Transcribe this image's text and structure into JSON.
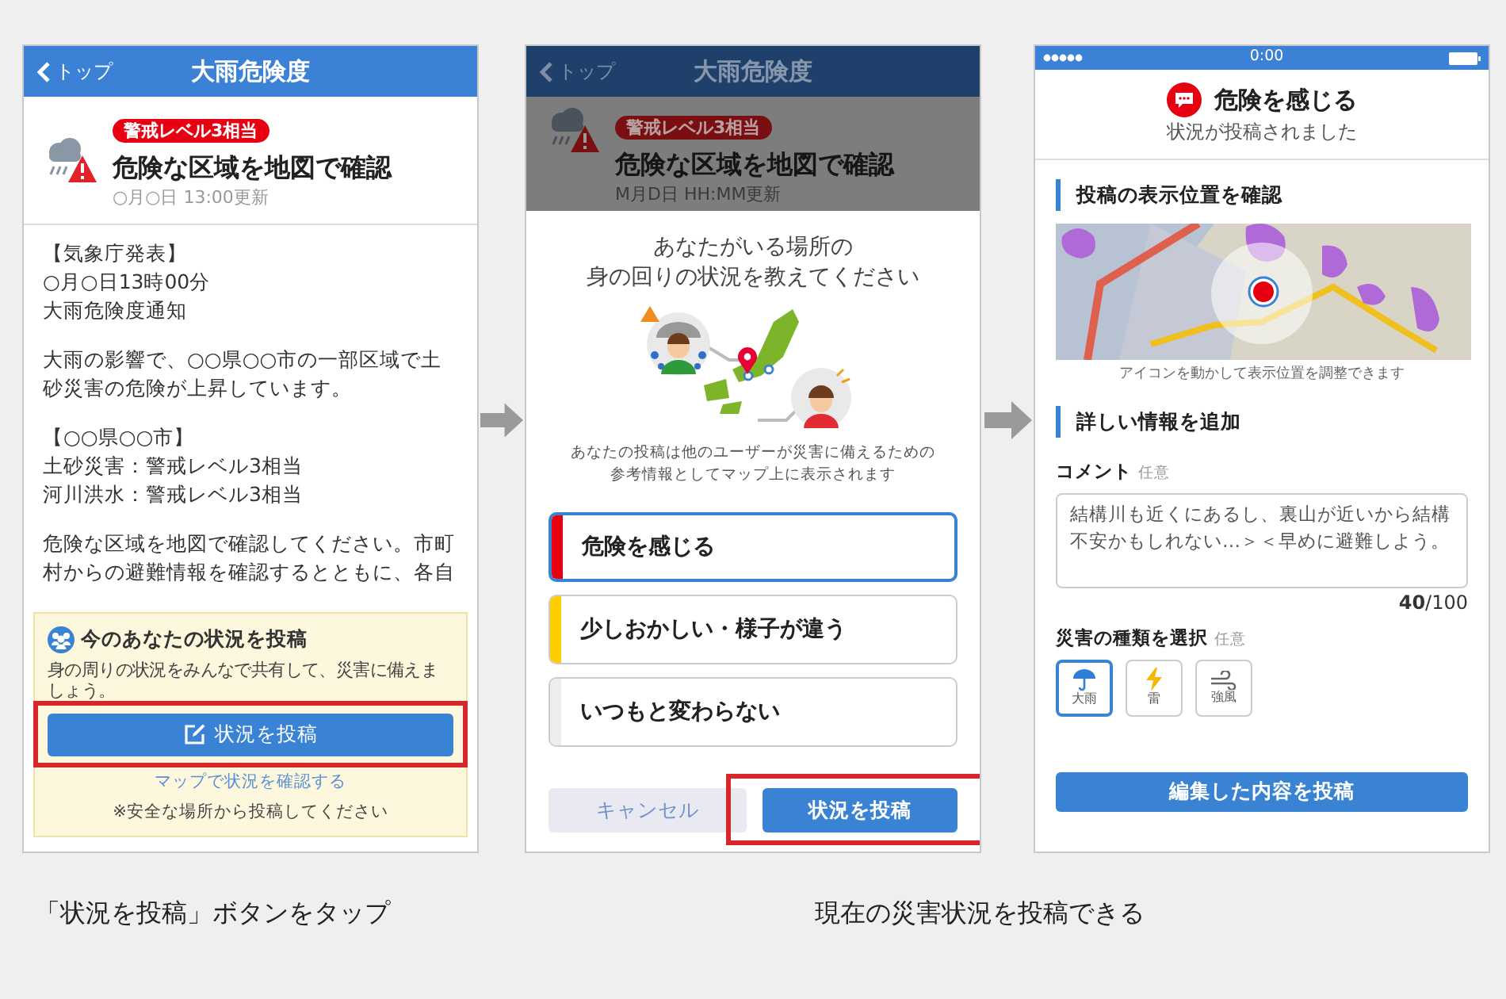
{
  "alert_screen": {
    "back": "トップ",
    "title": "大雨危険度",
    "badge": "警戒レベル3相当",
    "headline": "危険な区域を地図で確認",
    "updated": "○月○日 13:00更新",
    "body": [
      [
        "【気象庁発表】",
        "○月○日13時00分",
        "大雨危険度通知"
      ],
      [
        "大雨の影響で、○○県○○市の一部区域で土砂災害の危険が上昇しています。"
      ],
      [
        "【○○県○○市】",
        "土砂災害：警戒レベル3相当",
        "河川洪水：警戒レベル3相当"
      ],
      [
        "危険な区域を地図で確認してください。市町村からの避難情報を確認するとともに、各自"
      ]
    ],
    "share_card": {
      "title": "今のあなたの状況を投稿",
      "description": "身の周りの状況をみんなで共有して、災害に備えましょう。",
      "button": "状況を投稿",
      "highlighted": true,
      "link": "マップで状況を確認する",
      "note": "※安全な場所から投稿してください"
    }
  },
  "post_sheet_screen": {
    "back": "トップ",
    "title": "大雨危険度",
    "badge": "警戒レベル3相当",
    "headline": "危険な区域を地図で確認",
    "updated": "M月D日 HH:MM更新",
    "question": [
      "あなたがいる場所の",
      "身の回りの状況を教えてください"
    ],
    "notice": [
      "あなたの投稿は他のユーザーが災害に備えるための",
      "参考情報としてマップ上に表示されます"
    ],
    "options": [
      {
        "label": "危険を感じる",
        "color": "#e60012",
        "selected": true
      },
      {
        "label": "少しおかしい・様子が違う",
        "color": "#ffcc00",
        "selected": false
      },
      {
        "label": "いつもと変わらない",
        "color": "#eeeeee",
        "selected": false
      }
    ],
    "cancel": "キャンセル",
    "submit": "状況を投稿",
    "submit_highlighted": true
  },
  "posted_screen": {
    "status_time": "0:00",
    "status_title": "危険を感じる",
    "status_subtitle": "状況が投稿されました",
    "location_heading": "投稿の表示位置を確認",
    "map_hint": "アイコンを動かして表示位置を調整できます",
    "details_heading": "詳しい情報を追加",
    "comment_label": "コメント",
    "comment_optional": "任意",
    "comment": "結構川も近くにあるし、裏山が近いから結構不安かもしれない…＞＜早めに避難しよう。",
    "counter": "**40**/100",
    "type_label": "災害の種類を選択",
    "type_optional": "任意",
    "types": [
      {
        "kind": "rain",
        "label": "大雨",
        "selected": true
      },
      {
        "kind": "thunder",
        "label": "雷",
        "selected": false
      },
      {
        "kind": "wind",
        "label": "強風",
        "selected": false
      }
    ],
    "submit": "編集した内容を投稿"
  },
  "captions": [
    "「状況を投稿」ボタンをタップ",
    "現在の災害状況を投稿できる"
  ]
}
